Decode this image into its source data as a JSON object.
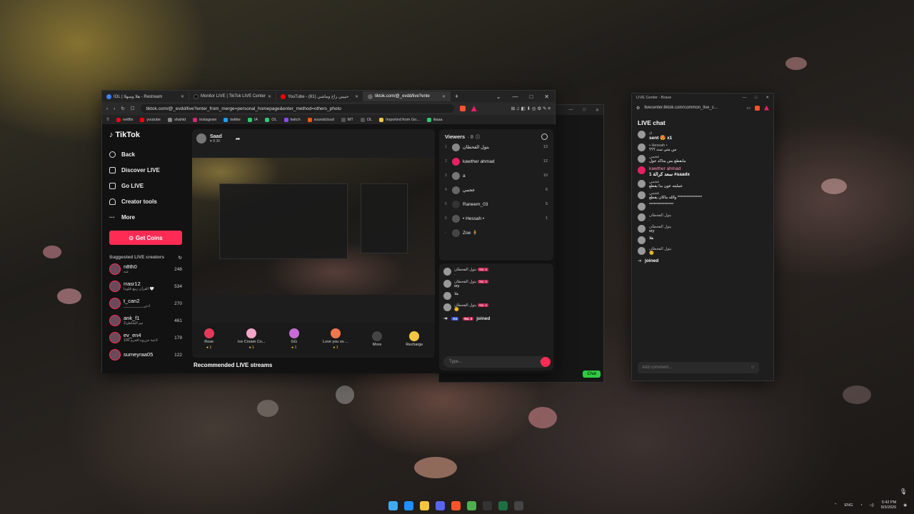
{
  "browser": {
    "tabs": [
      {
        "label": "IOL | هلا وسهلا - Restream",
        "color": "#3b82f6",
        "active": false
      },
      {
        "label": "Monitor LIVE | TikTok LIVE Center",
        "color": "#111111",
        "active": false
      },
      {
        "label": "YouTube - حبيبي راح وماشي (61)",
        "color": "#ff0000",
        "active": false
      },
      {
        "label": "tiktok.com/@_evdd/live?ente",
        "color": "#666666",
        "active": true
      }
    ],
    "url": "tiktok.com/@_evdd/live?enter_from_merge=personal_homepage&enter_method=others_photo",
    "bookmarks": [
      {
        "label": "netflix",
        "color": "#e50914"
      },
      {
        "label": "youtube",
        "color": "#ff0000"
      },
      {
        "label": "shahid",
        "color": "#888888"
      },
      {
        "label": "instagram",
        "color": "#d62976"
      },
      {
        "label": "twitter",
        "color": "#1da1f2"
      },
      {
        "label": "IA",
        "color": "#2ecc71"
      },
      {
        "label": "OL",
        "color": "#2ecc71"
      },
      {
        "label": "twitch",
        "color": "#9146ff"
      },
      {
        "label": "soundcloud",
        "color": "#ff5500"
      },
      {
        "label": "MT",
        "color": "#555555"
      },
      {
        "label": "OL",
        "color": "#555555"
      },
      {
        "label": "Imported from Go...",
        "color": "#f5c542"
      },
      {
        "label": "iiiaaa",
        "color": "#2ecc71"
      }
    ]
  },
  "tiktok": {
    "logo": "TikTok",
    "nav": [
      "Back",
      "Discover LIVE",
      "Go LIVE",
      "Creator tools",
      "More"
    ],
    "get_coins": "Get Coins",
    "suggested_title": "Suggested LIVE creators",
    "creators": [
      {
        "name": "n8th0",
        "sub": "عنه",
        "count": "248"
      },
      {
        "name": "rrasr12",
        "sub": "القرآن ربيع قلوبنا 🤍",
        "count": "534"
      },
      {
        "name": "t_can2",
        "sub": "__________ادتي",
        "count": "270"
      },
      {
        "name": "ank_f1",
        "sub": "نيم الشاطئ2",
        "count": "461"
      },
      {
        "name": "ev_en4",
        "sub": "100 لاعبة حزروه الحرم",
        "count": "179"
      },
      {
        "name": "sumeyraa05",
        "sub": "",
        "count": "122"
      }
    ],
    "host": {
      "name": "Saad",
      "likes": "8.3K"
    },
    "gifts": [
      {
        "label": "Rose",
        "price": "1",
        "color": "#e23b5a"
      },
      {
        "label": "Ice Cream Co...",
        "price": "1",
        "color": "#f4a6c8"
      },
      {
        "label": "GG",
        "price": "1",
        "color": "#c86bd8"
      },
      {
        "label": "Love you so ...",
        "price": "1",
        "color": "#f2764b"
      },
      {
        "label": "More",
        "price": "",
        "color": "#444444"
      },
      {
        "label": "Recharge",
        "price": "",
        "color": "#f5c542"
      }
    ],
    "recommended": "Recommended LIVE streams",
    "viewers_title": "Viewers",
    "viewers_count": "· 8",
    "viewers": [
      {
        "rank": "1",
        "name": "بتول القحطان",
        "score": "13"
      },
      {
        "rank": "2",
        "name": "kawther ahmad",
        "score": "12"
      },
      {
        "rank": "3",
        "name": "a",
        "score": "10"
      },
      {
        "rank": "4",
        "name": "عجمي",
        "score": "6"
      },
      {
        "rank": "5",
        "name": "Raneem_03",
        "score": "5"
      },
      {
        "rank": "6",
        "name": "• Hessah •",
        "score": "1"
      },
      {
        "rank": "-",
        "name": "Zoe 🧍",
        "score": ""
      }
    ],
    "chat": [
      {
        "name": "بتول القحطان",
        "badge": "No. 1",
        "text": "."
      },
      {
        "name": "بتول القحطان",
        "badge": "No. 1",
        "text": "sry"
      },
      {
        "name": "هلا",
        "badge": "",
        "text": ""
      },
      {
        "name": "بتول القحطان",
        "badge": "No. 1",
        "text": "😊"
      }
    ],
    "joined_text": "joined",
    "type_placeholder": "Type..."
  },
  "monitor": {
    "chat_button": "Chat"
  },
  "live_center": {
    "title": "LIVE Center - Brave",
    "url": "livecenter.tiktok.com/common_live_c...",
    "heading": "LIVE chat",
    "messages": [
      {
        "name": "ي",
        "text": "sent 😍 x1",
        "bold": true
      },
      {
        "name": "• Hessah •",
        "text": "من متى تبث ؟؟؟",
        "bold": false
      },
      {
        "name": "عجمي",
        "text": "مابقطع بس متاكد جول",
        "bold": false
      },
      {
        "name": "kawther ahmad",
        "text": "سعد كرالة 1 #saadx",
        "bold": true
      },
      {
        "name": "عجمي",
        "text": "عمليته عون بدا يقطع",
        "bold": false
      },
      {
        "name": "عجمي",
        "text": "والله ماكان يقطع ****************",
        "bold": false
      },
      {
        "name": "",
        "text": "****************",
        "bold": false
      },
      {
        "name": "بتول القحطان",
        "text": ".",
        "bold": false
      },
      {
        "name": "بتول القحطان",
        "text": "sry",
        "bold": false
      },
      {
        "name": "",
        "text": "هلا",
        "bold": false
      },
      {
        "name": "بتول القحطان",
        "text": "😊",
        "bold": false
      }
    ],
    "joined": "joined",
    "add_comment": "Add comment..."
  },
  "taskbar": {
    "icons": [
      "windows-icon",
      "edge-icon",
      "files-icon",
      "discord-icon",
      "brave-icon",
      "chrome-icon",
      "app-icon",
      "excel-icon",
      "obs-icon"
    ],
    "lang": "ENG",
    "time": "5:42 PM",
    "date": "8/3/2026"
  }
}
